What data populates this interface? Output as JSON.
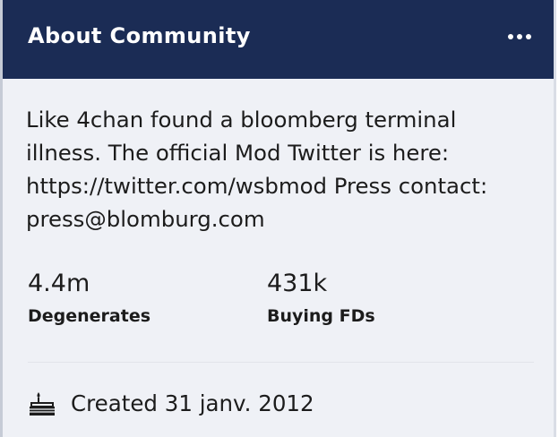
{
  "header": {
    "title": "About Community",
    "more_icon": "more-horizontal-icon"
  },
  "description": "Like 4chan found a bloomberg terminal illness. The official Mod Twitter is here: https://twitter.com/wsbmod Press contact: press@blomburg.com",
  "stats": {
    "members": {
      "value": "4.4m",
      "label": "Degenerates"
    },
    "online": {
      "value": "431k",
      "label": "Buying FDs"
    }
  },
  "created": {
    "icon": "cake-icon",
    "text": "Created 31 janv. 2012"
  },
  "colors": {
    "header_bg": "#1b2c55",
    "card_bg": "#eff1f6",
    "text": "#1c1c1c"
  }
}
